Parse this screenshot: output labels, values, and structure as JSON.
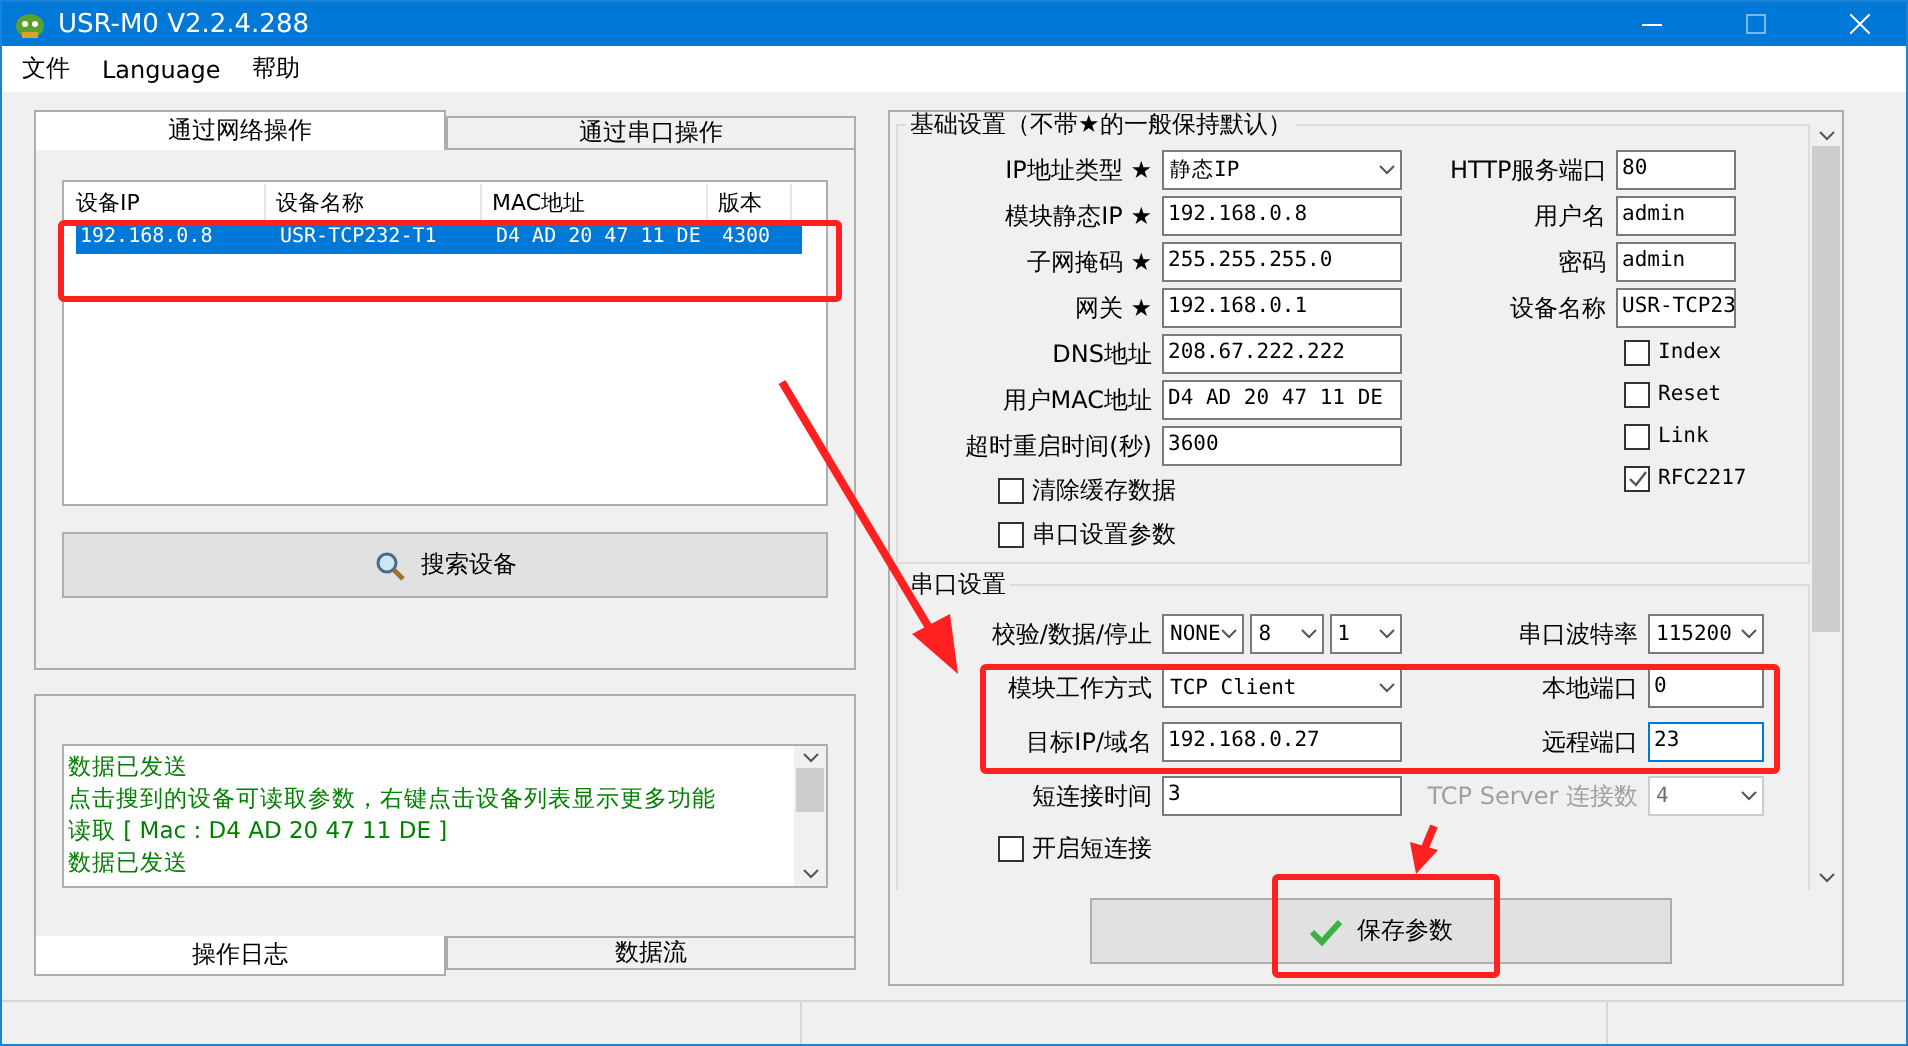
{
  "window": {
    "title": "USR-M0 V2.2.4.288"
  },
  "menu": [
    "文件",
    "Language",
    "帮助"
  ],
  "operation_tabs": [
    {
      "label": "通过网络操作",
      "selected": true
    },
    {
      "label": "通过串口操作",
      "selected": false
    }
  ],
  "device_list": {
    "columns": [
      "设备IP",
      "设备名称",
      "MAC地址",
      "版本"
    ],
    "rows": [
      {
        "cells": [
          "192.168.0.8",
          "USR-TCP232-T1",
          "D4 AD 20 47 11 DE",
          "4300"
        ],
        "selected": true
      }
    ]
  },
  "search_button": "搜索设备",
  "log": [
    "数据已发送",
    "点击搜到的设备可读取参数，右键点击设备列表显示更多功能",
    "读取 [ Mac : D4 AD 20 47 11 DE ]",
    "数据已发送"
  ],
  "log_tabs": [
    {
      "label": "操作日志",
      "selected": true
    },
    {
      "label": "数据流",
      "selected": false
    }
  ],
  "basic_settings": {
    "title": "基础设置（不带★的一般保持默认）",
    "left_fields": [
      {
        "label": "IP地址类型 ★",
        "inputs": [
          {
            "kind": "select",
            "value": "静态IP"
          }
        ]
      },
      {
        "label": "模块静态IP ★",
        "inputs": [
          {
            "kind": "input",
            "value": "192.168.0.8"
          }
        ]
      },
      {
        "label": "子网掩码 ★",
        "inputs": [
          {
            "kind": "input",
            "value": "255.255.255.0"
          }
        ]
      },
      {
        "label": "网关 ★",
        "inputs": [
          {
            "kind": "input",
            "value": "192.168.0.1"
          }
        ]
      },
      {
        "label": "DNS地址",
        "inputs": [
          {
            "kind": "input",
            "value": "208.67.222.222"
          }
        ]
      },
      {
        "label": "用户MAC地址",
        "inputs": [
          {
            "kind": "input",
            "value": "D4 AD 20 47 11 DE"
          }
        ]
      },
      {
        "label": "超时重启时间(秒)",
        "inputs": [
          {
            "kind": "input",
            "value": "3600"
          }
        ]
      }
    ],
    "left_checkboxes": [
      {
        "label": "清除缓存数据",
        "checked": false
      },
      {
        "label": "串口设置参数",
        "checked": false
      }
    ],
    "right_fields": [
      {
        "label": "HTTP服务端口",
        "inputs": [
          {
            "kind": "input",
            "value": "80"
          }
        ]
      },
      {
        "label": "用户名",
        "inputs": [
          {
            "kind": "input",
            "value": "admin"
          }
        ]
      },
      {
        "label": "密码",
        "inputs": [
          {
            "kind": "input",
            "value": "admin"
          }
        ]
      },
      {
        "label": "设备名称",
        "inputs": [
          {
            "kind": "input",
            "value": "USR-TCP23"
          }
        ]
      }
    ],
    "right_checkboxes": [
      {
        "label": "Index",
        "checked": false
      },
      {
        "label": "Reset",
        "checked": false
      },
      {
        "label": "Link",
        "checked": false
      },
      {
        "label": "RFC2217",
        "checked": true
      }
    ]
  },
  "serial_settings": {
    "title": "串口设置",
    "rows": [
      {
        "left": {
          "label": "校验/数据/停止",
          "inputs": [
            {
              "kind": "select",
              "value": "NONE"
            },
            {
              "kind": "select",
              "value": "8"
            },
            {
              "kind": "select",
              "value": "1"
            }
          ]
        },
        "right": {
          "label": "串口波特率",
          "disabled": false,
          "inputs": [
            {
              "kind": "select",
              "value": "115200"
            }
          ]
        }
      },
      {
        "left": {
          "label": "模块工作方式",
          "inputs": [
            {
              "kind": "select",
              "value": "TCP Client"
            }
          ]
        },
        "right": {
          "label": "本地端口",
          "disabled": false,
          "inputs": [
            {
              "kind": "input",
              "value": "0",
              "focused": false
            }
          ]
        }
      },
      {
        "left": {
          "label": "目标IP/域名",
          "inputs": [
            {
              "kind": "input",
              "value": "192.168.0.27"
            }
          ]
        },
        "right": {
          "label": "远程端口",
          "disabled": false,
          "inputs": [
            {
              "kind": "input",
              "value": "23",
              "focused": true
            }
          ]
        }
      },
      {
        "left": {
          "label": "短连接时间",
          "inputs": [
            {
              "kind": "input",
              "value": "3"
            }
          ]
        },
        "right": {
          "label": "TCP Server 连接数",
          "disabled": true,
          "inputs": [
            {
              "kind": "select",
              "value": "4"
            }
          ]
        }
      }
    ],
    "checkboxes": [
      {
        "label": "开启短连接",
        "checked": false
      }
    ]
  },
  "save_button": "保存参数"
}
